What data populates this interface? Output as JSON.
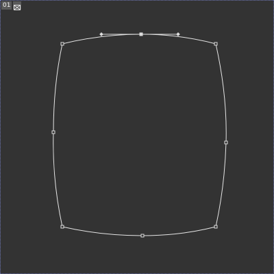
{
  "viewport": {
    "number_label": "01",
    "close_icon": "close-icon",
    "accent_border_color": "#6f79b8",
    "background_color": "#333333"
  }
}
